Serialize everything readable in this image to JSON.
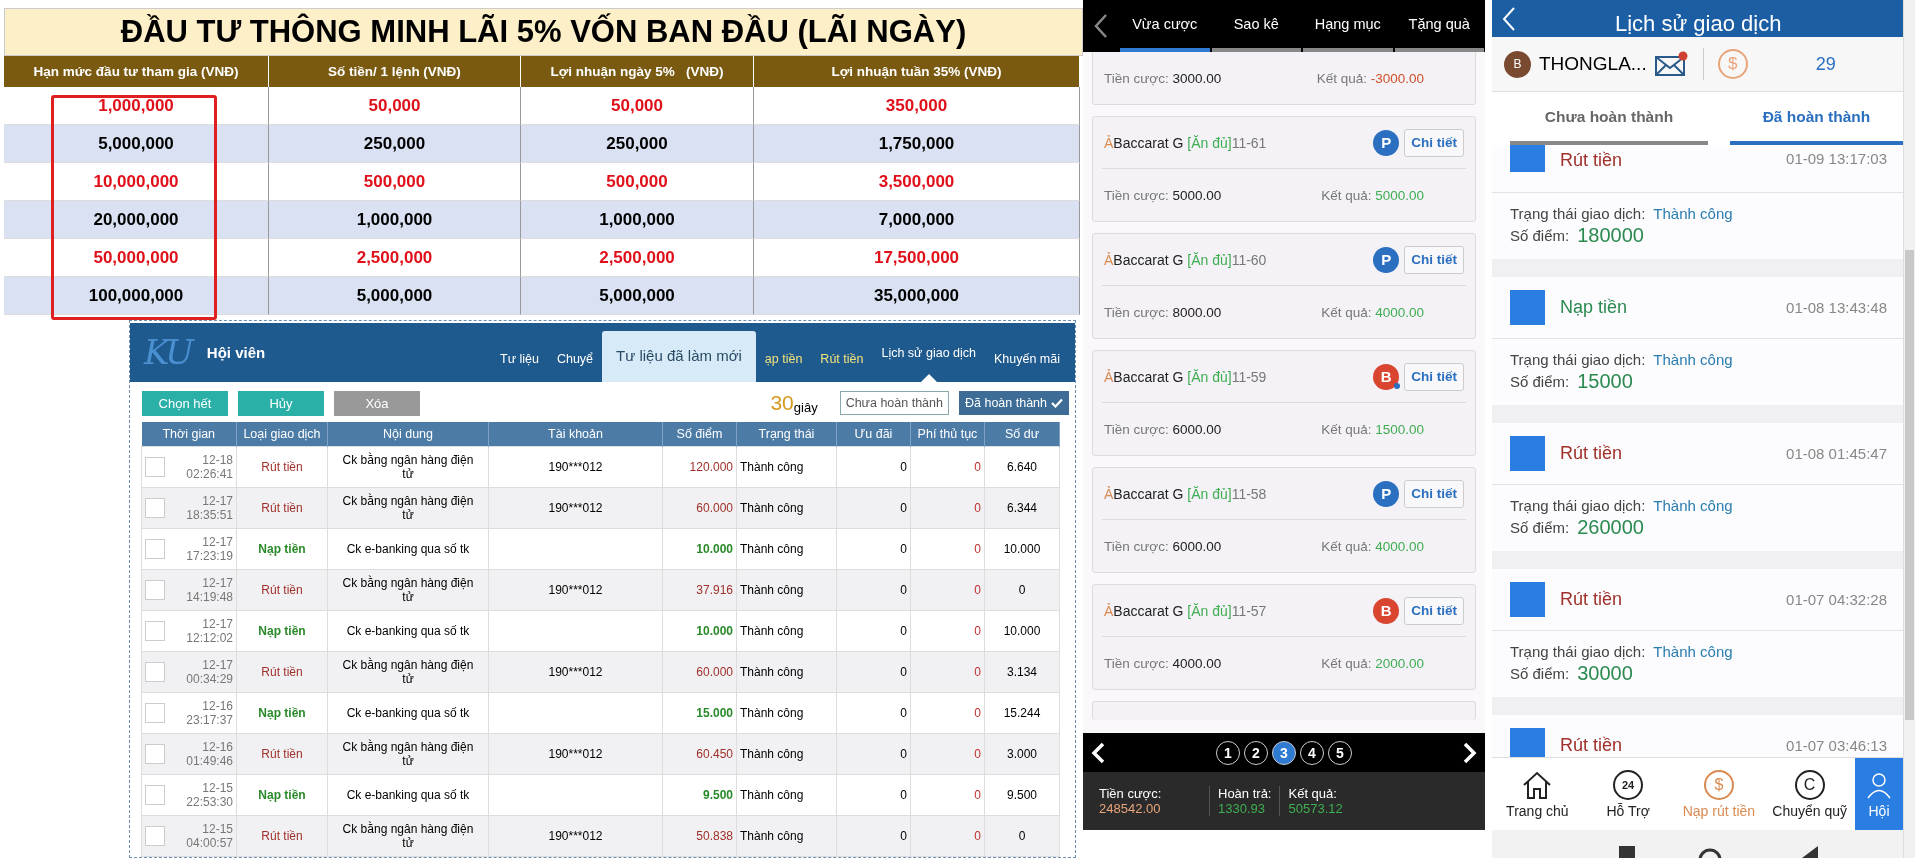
{
  "investment_table": {
    "title": "ĐẦU TƯ THÔNG MINH LÃI 5% VỐN BAN ĐẦU (LÃI NGÀY)",
    "first_column_highlighted": true,
    "columns": [
      "Hạn mức đầu tư tham gia (VNĐ)",
      "Số tiền/ 1 lệnh (VNĐ)",
      "Lợi nhuận ngày 5%   (VNĐ)",
      "Lợi nhuận tuần 35% (VNĐ)"
    ],
    "rows": [
      {
        "emphasized": true,
        "cells": [
          "1,000,000",
          "50,000",
          "50,000",
          "350,000"
        ]
      },
      {
        "emphasized": false,
        "cells": [
          "5,000,000",
          "250,000",
          "250,000",
          "1,750,000"
        ]
      },
      {
        "emphasized": true,
        "cells": [
          "10,000,000",
          "500,000",
          "500,000",
          "3,500,000"
        ]
      },
      {
        "emphasized": false,
        "cells": [
          "20,000,000",
          "1,000,000",
          "1,000,000",
          "7,000,000"
        ]
      },
      {
        "emphasized": true,
        "cells": [
          "50,000,000",
          "2,500,000",
          "2,500,000",
          "17,500,000"
        ]
      },
      {
        "emphasized": false,
        "cells": [
          "100,000,000",
          "5,000,000",
          "5,000,000",
          "35,000,000"
        ]
      }
    ]
  },
  "member_panel": {
    "logo": "KU",
    "title": "Hội viên",
    "notice": "Tư liệu đã làm mới",
    "nav": [
      {
        "label": "Tư liệu",
        "highlighted": false,
        "selected": false
      },
      {
        "label": "Chuyể",
        "highlighted": false,
        "selected": false
      },
      {
        "label": "ạp tiền",
        "highlighted": true,
        "selected": false
      },
      {
        "label": "Rút tiền",
        "highlighted": true,
        "selected": false
      },
      {
        "label": "Lịch sử giao dịch",
        "highlighted": false,
        "selected": true
      },
      {
        "label": "Khuyến mãi",
        "highlighted": false,
        "selected": false
      }
    ],
    "actions": [
      {
        "label": "Chọn hết",
        "disabled": false
      },
      {
        "label": "Hủy",
        "disabled": false
      },
      {
        "label": "Xóa",
        "disabled": true
      }
    ],
    "countdown": {
      "value": "30",
      "unit": "giây"
    },
    "filters": [
      {
        "label": "Chưa hoàn thành",
        "selected": false
      },
      {
        "label": "Đã hoàn thành",
        "selected": true
      }
    ],
    "columns": [
      "Thời gian",
      "Loại giao dịch",
      "Nội dung",
      "Tài khoản",
      "Số điểm",
      "Trạng thái",
      "Ưu đãi",
      "Phí thủ tục",
      "Số dư"
    ],
    "rows": [
      {
        "checked": false,
        "date": "12-18",
        "time": "02:26:41",
        "kind": "withdraw",
        "type": "Rút tiền",
        "content": "Ck bằng ngân hàng điện tử",
        "account": "190***012",
        "points": "120.000",
        "status": "Thành công",
        "promo": "0",
        "fee": "0",
        "balance": "6.640"
      },
      {
        "checked": false,
        "date": "12-17",
        "time": "18:35:51",
        "kind": "withdraw",
        "type": "Rút tiền",
        "content": "Ck bằng ngân hàng điện tử",
        "account": "190***012",
        "points": "60.000",
        "status": "Thành công",
        "promo": "0",
        "fee": "0",
        "balance": "6.344"
      },
      {
        "checked": false,
        "date": "12-17",
        "time": "17:23:19",
        "kind": "deposit",
        "type": "Nạp tiền",
        "content": "Ck e-banking qua số tk",
        "points": "10.000",
        "status": "Thành công",
        "promo": "0",
        "fee": "0",
        "balance": "10.000"
      },
      {
        "checked": false,
        "date": "12-17",
        "time": "14:19:48",
        "kind": "withdraw",
        "type": "Rút tiền",
        "content": "Ck bằng ngân hàng điện tử",
        "account": "190***012",
        "points": "37.916",
        "status": "Thành công",
        "promo": "0",
        "fee": "0",
        "balance": "0"
      },
      {
        "checked": false,
        "date": "12-17",
        "time": "12:12:02",
        "kind": "deposit",
        "type": "Nạp tiền",
        "content": "Ck e-banking qua số tk",
        "points": "10.000",
        "status": "Thành công",
        "promo": "0",
        "fee": "0",
        "balance": "10.000"
      },
      {
        "checked": false,
        "date": "12-17",
        "time": "00:34:29",
        "kind": "withdraw",
        "type": "Rút tiền",
        "content": "Ck bằng ngân hàng điện tử",
        "account": "190***012",
        "points": "60.000",
        "status": "Thành công",
        "promo": "0",
        "fee": "0",
        "balance": "3.134"
      },
      {
        "checked": false,
        "date": "12-16",
        "time": "23:17:37",
        "kind": "deposit",
        "type": "Nạp tiền",
        "content": "Ck e-banking qua số tk",
        "points": "15.000",
        "status": "Thành công",
        "promo": "0",
        "fee": "0",
        "balance": "15.244"
      },
      {
        "checked": false,
        "date": "12-16",
        "time": "01:49:46",
        "kind": "withdraw",
        "type": "Rút tiền",
        "content": "Ck bằng ngân hàng điện tử",
        "account": "190***012",
        "points": "60.450",
        "status": "Thành công",
        "promo": "0",
        "fee": "0",
        "balance": "3.000"
      },
      {
        "checked": false,
        "date": "12-15",
        "time": "22:53:30",
        "kind": "deposit",
        "type": "Nạp tiền",
        "content": "Ck e-banking qua số tk",
        "points": "9.500",
        "status": "Thành công",
        "promo": "0",
        "fee": "0",
        "balance": "9.500"
      },
      {
        "checked": false,
        "date": "12-15",
        "time": "04:00:57",
        "kind": "withdraw",
        "type": "Rút tiền",
        "content": "Ck bằng ngân hàng điện tử",
        "account": "190***012",
        "points": "50.838",
        "status": "Thành công",
        "promo": "0",
        "fee": "0",
        "balance": "0"
      }
    ]
  },
  "bet_history": {
    "tabs": [
      {
        "label": "Vừa cược",
        "selected": true
      },
      {
        "label": "Sao kê",
        "selected": false
      },
      {
        "label": "Hạng mục",
        "selected": false
      },
      {
        "label": "Tặng quà",
        "selected": false
      }
    ],
    "partial_card": {
      "bet_label": "Tiền cược:",
      "bet": "3000.00",
      "result_label": "Kết quả:",
      "result": "-3000.00",
      "kind": "loss"
    },
    "cards": [
      {
        "prefix": "Ả",
        "game": "Baccarat G ",
        "tag": "[Ăn đủ]",
        "round": "11-61",
        "badge": "P",
        "color": "#2a6fc0",
        "dot": false,
        "action": "Chi tiết",
        "bet_label": "Tiền cược:",
        "bet": "5000.00",
        "result_label": "Kết quả:",
        "result": "5000.00",
        "kind": "win"
      },
      {
        "prefix": "Ả",
        "game": "Baccarat G ",
        "tag": "[Ăn đủ]",
        "round": "11-60",
        "badge": "P",
        "color": "#2a6fc0",
        "dot": false,
        "action": "Chi tiết",
        "bet_label": "Tiền cược:",
        "bet": "8000.00",
        "result_label": "Kết quả:",
        "result": "4000.00",
        "kind": "win"
      },
      {
        "prefix": "Ả",
        "game": "Baccarat G ",
        "tag": "[Ăn đủ]",
        "round": "11-59",
        "badge": "B",
        "color": "#d9452f",
        "dot": true,
        "action": "Chi tiết",
        "bet_label": "Tiền cược:",
        "bet": "6000.00",
        "result_label": "Kết quả:",
        "result": "1500.00",
        "kind": "win"
      },
      {
        "prefix": "Ả",
        "game": "Baccarat G ",
        "tag": "[Ăn đủ]",
        "round": "11-58",
        "badge": "P",
        "color": "#2a6fc0",
        "dot": false,
        "action": "Chi tiết",
        "bet_label": "Tiền cược:",
        "bet": "6000.00",
        "result_label": "Kết quả:",
        "result": "4000.00",
        "kind": "win"
      },
      {
        "prefix": "Ả",
        "game": "Baccarat G ",
        "tag": "[Ăn đủ]",
        "round": "11-57",
        "badge": "B",
        "color": "#d9452f",
        "dot": false,
        "action": "Chi tiết",
        "bet_label": "Tiền cược:",
        "bet": "4000.00",
        "result_label": "Kết quả:",
        "result": "2000.00",
        "kind": "win"
      }
    ],
    "pages": [
      {
        "label": "1",
        "selected": false
      },
      {
        "label": "2",
        "selected": false
      },
      {
        "label": "3",
        "selected": true
      },
      {
        "label": "4",
        "selected": false
      },
      {
        "label": "5",
        "selected": false
      }
    ],
    "summary": [
      {
        "label": "Tiền cược:",
        "value": "248542.00",
        "color": "#e9a57a"
      },
      {
        "label": "Hoàn trả:",
        "value": "1330.93",
        "color": "#3fae52"
      },
      {
        "label": "Kết quả:",
        "value": "50573.12",
        "color": "#3fae52"
      }
    ]
  },
  "transaction_history": {
    "title": "Lịch sử giao dịch",
    "user": {
      "avatar": "B",
      "name": "THONGLA...",
      "has_unread": true,
      "coin_glyph": "$",
      "count": "29"
    },
    "tabs": [
      {
        "label": "Chưa hoàn thành",
        "selected": false
      },
      {
        "label": "Đã hoàn thành",
        "selected": true
      }
    ],
    "items": [
      {
        "kind": "withdraw",
        "type": "Rút tiền",
        "time": "01-09 13:17:03",
        "status_label": "Trạng thái giao dịch:",
        "status": "Thành công",
        "points_label": "Số điểm:",
        "points": "180000"
      },
      {
        "kind": "deposit",
        "type": "Nạp tiền",
        "time": "01-08 13:43:48",
        "status_label": "Trạng thái giao dịch:",
        "status": "Thành công",
        "points_label": "Số điểm:",
        "points": "15000"
      },
      {
        "kind": "withdraw",
        "type": "Rút tiền",
        "time": "01-08 01:45:47",
        "status_label": "Trạng thái giao dịch:",
        "status": "Thành công",
        "points_label": "Số điểm:",
        "points": "260000"
      },
      {
        "kind": "withdraw",
        "type": "Rút tiền",
        "time": "01-07 04:32:28",
        "status_label": "Trạng thái giao dịch:",
        "status": "Thành công",
        "points_label": "Số điểm:",
        "points": "30000"
      },
      {
        "kind": "withdraw",
        "type": "Rút tiền",
        "time": "01-07 03:46:13"
      }
    ],
    "nav": [
      {
        "label": "Trang chủ",
        "accent": false,
        "selected": false
      },
      {
        "label": "Hỗ Trợ",
        "glyph": "24",
        "accent": false,
        "selected": false
      },
      {
        "label": "Nạp rút tiền",
        "glyph": "$",
        "accent": true,
        "selected": false
      },
      {
        "label": "Chuyển quỹ",
        "glyph": "C",
        "accent": false,
        "selected": false
      },
      {
        "label": "Hội",
        "accent": false,
        "selected": true
      }
    ]
  }
}
